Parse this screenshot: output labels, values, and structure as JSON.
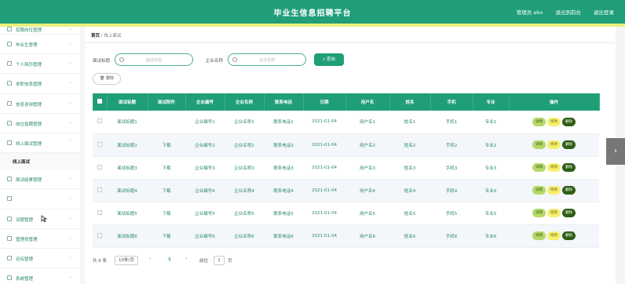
{
  "header": {
    "title": "毕业生信息招聘平台",
    "admin": "管理员 abo",
    "back_home": "退出到前台",
    "logout": "退出登录"
  },
  "sidebar": {
    "items": [
      {
        "label": "招聘岗位管理",
        "icon": "grid-icon"
      },
      {
        "label": "毕业生管理",
        "icon": "user-icon"
      },
      {
        "label": "个人简历管理",
        "icon": "chart-icon"
      },
      {
        "label": "求职信息管理",
        "icon": "list-icon"
      },
      {
        "label": "信息咨询管理",
        "icon": "chat-icon"
      },
      {
        "label": "岗位投聘管理",
        "icon": "table-icon"
      },
      {
        "label": "线上面试管理",
        "icon": "menu-icon"
      }
    ],
    "sub": "线上面试",
    "items2": [
      {
        "label": "面试结果管理",
        "icon": "list-icon"
      },
      {
        "label": "",
        "icon": "menu-icon"
      },
      {
        "label": "试题管理",
        "icon": "user-icon"
      },
      {
        "label": "管理员管理",
        "icon": "grid-icon"
      },
      {
        "label": "论坛管理",
        "icon": "chat-icon"
      },
      {
        "label": "系统管理",
        "icon": "gear-icon"
      }
    ]
  },
  "breadcrumb": {
    "home": "首页",
    "sep": "/",
    "current": "线上面试"
  },
  "filters": {
    "interview_title_label": "面试标题",
    "interview_title_placeholder": "面试标题",
    "company_name_label": "企业名称",
    "company_name_placeholder": "企业名称",
    "search_label": "查询"
  },
  "actions": {
    "delete_label": "删除"
  },
  "table": {
    "headers": [
      "面试标题",
      "面试附件",
      "企业编号",
      "企业名称",
      "联系电话",
      "日期",
      "用户名",
      "姓名",
      "手机",
      "专业",
      "操作"
    ],
    "op_labels": {
      "detail": "详情",
      "edit": "修改",
      "delete": "删除"
    },
    "rows": [
      {
        "title": "面试标题1",
        "file": "",
        "company_no": "企业编号1",
        "company_name": "企业名称1",
        "phone": "联系电话1",
        "date": "2021-01-04",
        "username": "用户名1",
        "name": "姓名1",
        "mobile": "手机1",
        "major": "专业1"
      },
      {
        "title": "面试标题2",
        "file": "下载",
        "company_no": "企业编号2",
        "company_name": "企业名称2",
        "phone": "联系电话2",
        "date": "2021-01-04",
        "username": "用户名2",
        "name": "姓名2",
        "mobile": "手机2",
        "major": "专业2"
      },
      {
        "title": "面试标题3",
        "file": "下载",
        "company_no": "企业编号3",
        "company_name": "企业名称3",
        "phone": "联系电话3",
        "date": "2021-01-04",
        "username": "用户名3",
        "name": "姓名3",
        "mobile": "手机3",
        "major": "专业3"
      },
      {
        "title": "面试标题4",
        "file": "下载",
        "company_no": "企业编号4",
        "company_name": "企业名称4",
        "phone": "联系电话4",
        "date": "2021-01-04",
        "username": "用户名4",
        "name": "姓名4",
        "mobile": "手机4",
        "major": "专业4"
      },
      {
        "title": "面试标题5",
        "file": "下载",
        "company_no": "企业编号5",
        "company_name": "企业名称5",
        "phone": "联系电话5",
        "date": "2021-01-04",
        "username": "用户名5",
        "name": "姓名5",
        "mobile": "手机5",
        "major": "专业5"
      },
      {
        "title": "面试标题6",
        "file": "下载",
        "company_no": "企业编号6",
        "company_name": "企业名称6",
        "phone": "联系电话6",
        "date": "2021-01-04",
        "username": "用户名6",
        "name": "姓名6",
        "mobile": "手机6",
        "major": "专业6"
      }
    ]
  },
  "pagination": {
    "total": "共 6 条",
    "page_size": "10条/页",
    "prev": "‹",
    "current": "1",
    "next": "›",
    "goto_label": "前往",
    "goto_value": "1",
    "page_suffix": "页"
  },
  "colors": {
    "primary": "#1f9e78",
    "detail": "#b5d86a",
    "edit": "#f5f06d",
    "delete": "#2e5e15"
  }
}
